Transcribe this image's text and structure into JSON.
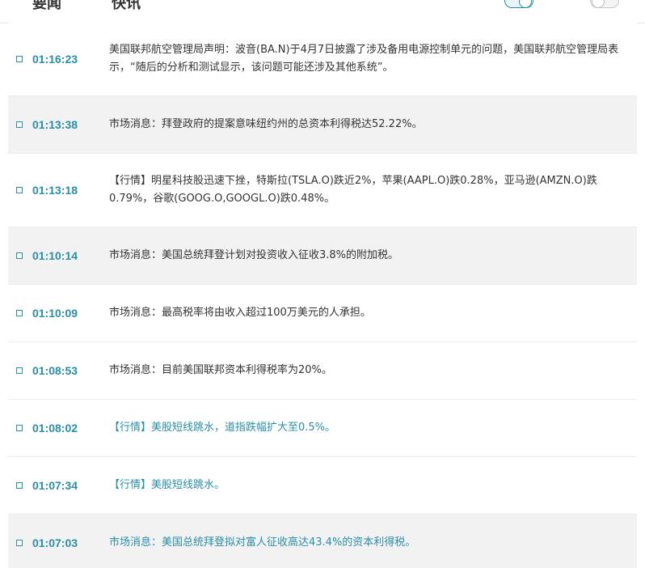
{
  "header": {
    "tabs": [
      {
        "label": "要闻"
      },
      {
        "label": "快讯"
      }
    ]
  },
  "feed": [
    {
      "time": "01:16:23",
      "text": "美国联邦航空管理局声明：波音(BA.N)于4月7日披露了涉及备用电源控制单元的问题，美国联邦航空管理局表示，“随后的分析和测试显示，该问题可能还涉及其他系统”。",
      "highlight": false
    },
    {
      "time": "01:13:38",
      "text": "市场消息：拜登政府的提案意味纽约州的总资本利得税达52.22%。",
      "highlight": false
    },
    {
      "time": "01:13:18",
      "text": "【行情】明星科技股迅速下挫，特斯拉(TSLA.O)跌近2%，苹果(AAPL.O)跌0.28%，亚马逊(AMZN.O)跌0.79%，谷歌(GOOG.O,GOOGL.O)跌0.48%。",
      "highlight": false
    },
    {
      "time": "01:10:14",
      "text": "市场消息：美国总统拜登计划对投资收入征收3.8%的附加税。",
      "highlight": false
    },
    {
      "time": "01:10:09",
      "text": "市场消息：最高税率将由收入超过100万美元的人承担。",
      "highlight": false
    },
    {
      "time": "01:08:53",
      "text": "市场消息：目前美国联邦资本利得税率为20%。",
      "highlight": false
    },
    {
      "time": "01:08:02",
      "text": "【行情】美股短线跳水，道指跌幅扩大至0.5%。",
      "highlight": true
    },
    {
      "time": "01:07:34",
      "text": "【行情】美股短线跳水。",
      "highlight": true
    },
    {
      "time": "01:07:03",
      "text": "市场消息：美国总统拜登拟对富人征收高达43.4%的资本利得税。",
      "highlight": true
    }
  ],
  "colors": {
    "accent": "#2a8fa6",
    "text": "#333333",
    "alt_row": "#f2f2f2"
  }
}
